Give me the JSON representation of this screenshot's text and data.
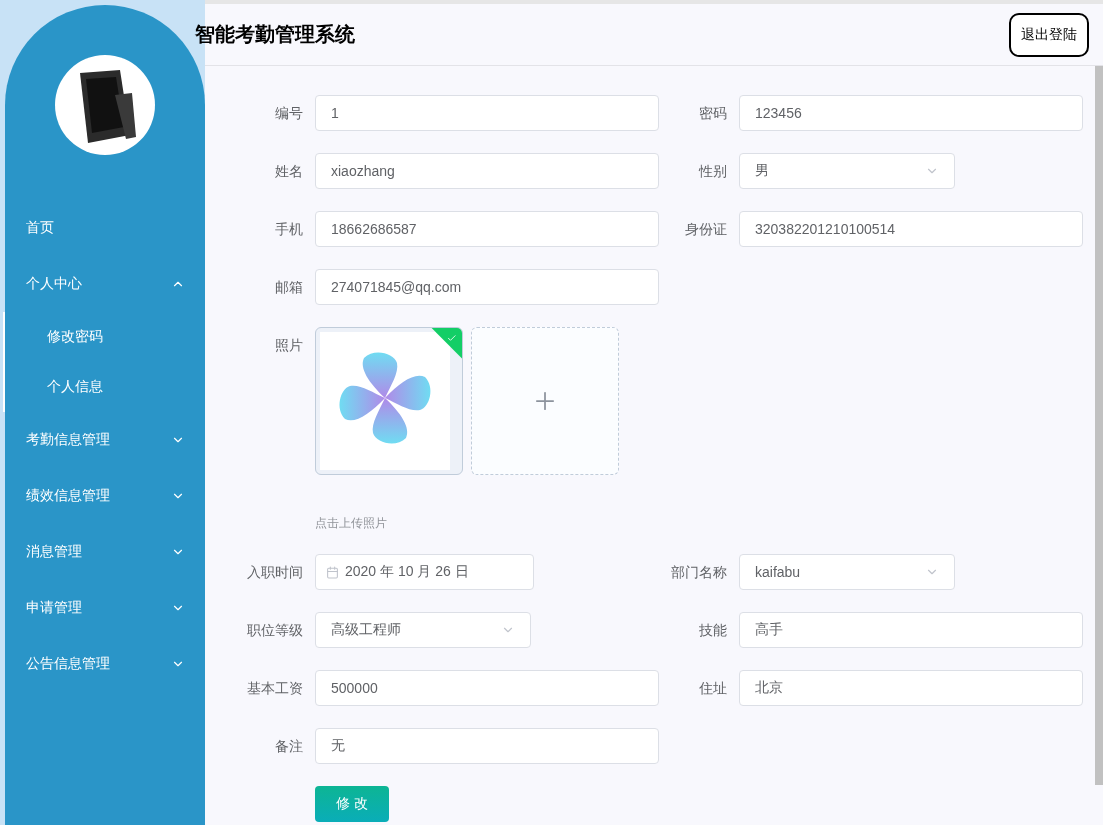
{
  "header": {
    "title": "智能考勤管理系统",
    "logout_button": "退出登陆"
  },
  "sidebar": {
    "menu": [
      {
        "label": "首页",
        "kind": "link"
      },
      {
        "label": "个人中心",
        "kind": "submenu",
        "expanded": true,
        "children": [
          {
            "label": "修改密码"
          },
          {
            "label": "个人信息"
          }
        ]
      },
      {
        "label": "考勤信息管理",
        "kind": "submenu",
        "expanded": false
      },
      {
        "label": "绩效信息管理",
        "kind": "submenu",
        "expanded": false
      },
      {
        "label": "消息管理",
        "kind": "submenu",
        "expanded": false
      },
      {
        "label": "申请管理",
        "kind": "submenu",
        "expanded": false
      },
      {
        "label": "公告信息管理",
        "kind": "submenu",
        "expanded": false
      }
    ]
  },
  "form": {
    "rows": [
      [
        {
          "label": "编号",
          "kind": "text",
          "value": "1"
        },
        {
          "label": "密码",
          "kind": "text",
          "value": "123456"
        }
      ],
      [
        {
          "label": "姓名",
          "kind": "text",
          "value": "xiaozhang"
        },
        {
          "label": "性别",
          "kind": "select",
          "value": "男"
        }
      ],
      [
        {
          "label": "手机",
          "kind": "text",
          "value": "18662686587"
        },
        {
          "label": "身份证",
          "kind": "text",
          "value": "320382201210100514"
        }
      ],
      [
        {
          "label": "邮箱",
          "kind": "text",
          "value": "274071845@qq.com"
        }
      ],
      [
        {
          "label": "照片",
          "kind": "upload",
          "uploaded": true,
          "hint": "点击上传照片"
        }
      ],
      [
        {
          "label": "入职时间",
          "kind": "date",
          "value": "2020 年 10 月 26 日"
        },
        {
          "label": "部门名称",
          "kind": "select",
          "value": "kaifabu"
        }
      ],
      [
        {
          "label": "职位等级",
          "kind": "select",
          "value": "高级工程师"
        },
        {
          "label": "技能",
          "kind": "text",
          "value": "高手"
        }
      ],
      [
        {
          "label": "基本工资",
          "kind": "text",
          "value": "500000"
        },
        {
          "label": "住址",
          "kind": "text",
          "value": "北京"
        }
      ],
      [
        {
          "label": "备注",
          "kind": "text",
          "value": "无"
        }
      ]
    ],
    "submit_button": "修 改"
  }
}
